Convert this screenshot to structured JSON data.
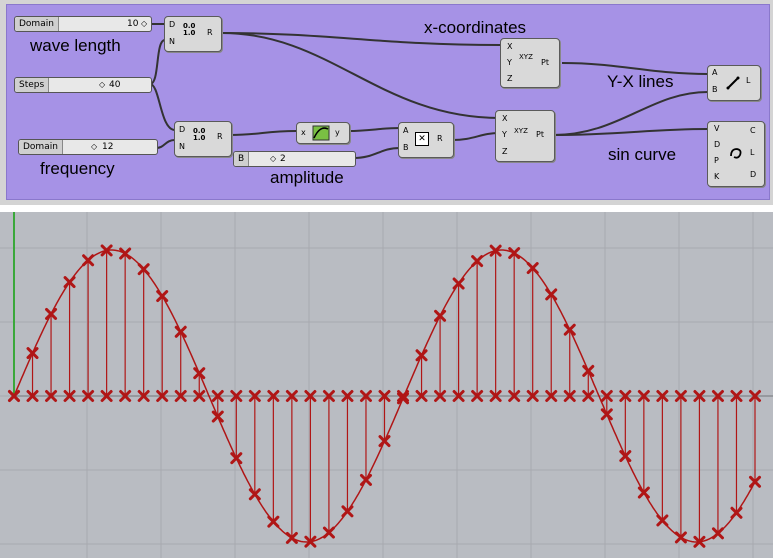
{
  "labels": {
    "wave_length": "wave length",
    "x_coordinates": "x-coordinates",
    "yx_lines": "Y-X  lines",
    "sin_curve": "sin curve",
    "frequency": "frequency",
    "amplitude": "amplitude"
  },
  "sliders": {
    "domain1": {
      "label": "Domain",
      "value": "10"
    },
    "steps": {
      "label": "Steps",
      "value": "40"
    },
    "domain2": {
      "label": "Domain",
      "value": "12"
    },
    "b": {
      "label": "B",
      "value": "2"
    }
  },
  "ports": {
    "range1_in_d": "D",
    "range1_in_n": "N",
    "range1_out_r": "R",
    "range2_in_d": "D",
    "range2_in_n": "N",
    "range2_out_r": "R",
    "sin_in": "x",
    "sin_out": "y",
    "mult_in_a": "A",
    "mult_in_b": "B",
    "mult_out": "R",
    "pt1_x": "X",
    "pt1_y": "Y",
    "pt1_z": "Z",
    "pt1_out": "Pt",
    "pt2_x": "X",
    "pt2_y": "Y",
    "pt2_z": "Z",
    "pt2_out": "Pt",
    "line_a": "A",
    "line_b": "B",
    "line_out": "L",
    "crv_v": "V",
    "crv_d": "D",
    "crv_p": "P",
    "crv_k": "K",
    "crv_c": "C",
    "crv_l": "L",
    "crv_dout": "D"
  },
  "icons": {
    "range": "0.0 / 1.0 range-icon",
    "xyz": "XYZ"
  },
  "plot": {
    "curve_color": "#b01616",
    "points": 41,
    "cycles": 1.9,
    "amplitude": 2
  }
}
